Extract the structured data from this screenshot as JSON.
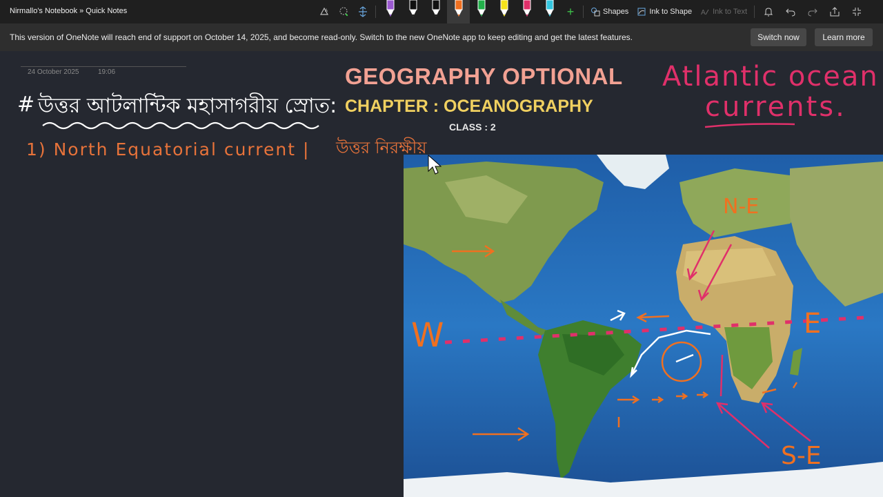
{
  "topbar": {
    "breadcrumb": "Nirmallo's Notebook » Quick Notes",
    "shapes_label": "Shapes",
    "ink_to_shape_label": "Ink to Shape",
    "ink_to_text_label": "Ink to Text",
    "pens": [
      {
        "name": "purple-pen",
        "color": "#9b59d0"
      },
      {
        "name": "black-pen",
        "color": "#111111"
      },
      {
        "name": "black-pen-2",
        "color": "#111111"
      },
      {
        "name": "orange-pen",
        "color": "#f07020"
      },
      {
        "name": "green-pen",
        "color": "#22b04a"
      },
      {
        "name": "yellow-highlighter",
        "color": "#f5e21a"
      },
      {
        "name": "pink-pen",
        "color": "#e0306a"
      },
      {
        "name": "cyan-pen",
        "color": "#33c6e0"
      }
    ]
  },
  "banner": {
    "message": "This version of OneNote will reach end of support on October 14, 2025, and become read-only. Switch to the new OneNote app to keep editing and get the latest features.",
    "switch_now": "Switch now",
    "learn_more": "Learn more"
  },
  "page": {
    "date": "24 October 2025",
    "time": "19:06",
    "title_line1": "GEOGRAPHY OPTIONAL",
    "title_line2": "CHAPTER : OCEANOGRAPHY",
    "class_label": "CLASS : 2"
  },
  "ink": {
    "hash": "#",
    "bengali_heading": "উত্তর আটলান্টিক মহাসাগরীয় স্রোত:",
    "north_equatorial": "1) North Equatorial current |",
    "bengali_small": "উত্তর নিরক্ষীয়",
    "atlantic_line1": "Atlantic ocean",
    "atlantic_line2": "currents."
  },
  "map_labels": {
    "ne": "N-E",
    "e": "E",
    "w": "W",
    "se": "S-E"
  }
}
